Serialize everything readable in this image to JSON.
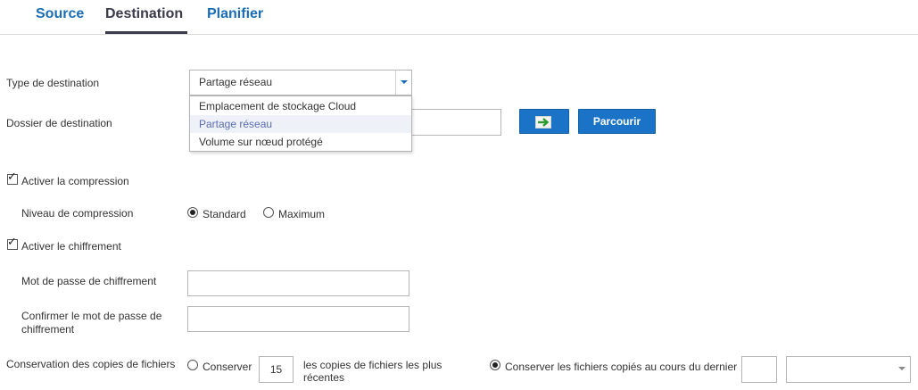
{
  "tabs": [
    {
      "label": "Source"
    },
    {
      "label": "Destination"
    },
    {
      "label": "Planifier"
    }
  ],
  "destination_type": {
    "label": "Type de destination",
    "selected": "Partage réseau",
    "options": [
      "Emplacement de stockage Cloud",
      "Partage réseau",
      "Volume sur nœud protégé"
    ]
  },
  "destination_folder": {
    "label": "Dossier de destination",
    "value": "",
    "go_icon": "arrow-right-icon",
    "browse_label": "Parcourir"
  },
  "compression": {
    "enable_label": "Activer la compression",
    "enabled": true,
    "level_label": "Niveau de compression",
    "options": [
      "Standard",
      "Maximum"
    ],
    "selected": "Standard"
  },
  "encryption": {
    "enable_label": "Activer le chiffrement",
    "enabled": true,
    "password_label": "Mot de passe de chiffrement",
    "confirm_label_line1": "Confirmer le mot de passe de",
    "confirm_label_line2": "chiffrement",
    "password_value": "",
    "confirm_value": ""
  },
  "retention": {
    "label": "Conservation des copies de fichiers",
    "keep_label": "Conserver",
    "keep_count": "15",
    "recent_label_line1": "les copies de fichiers les plus",
    "recent_label_line2": "récentes",
    "period_label": "Conserver les fichiers copiés au cours du dernier",
    "period_value": "",
    "period_unit": "",
    "selected": "period"
  },
  "colors": {
    "accent": "#1a73c7",
    "tab_link": "#1a6db5",
    "tab_active": "#3a3a4a"
  }
}
